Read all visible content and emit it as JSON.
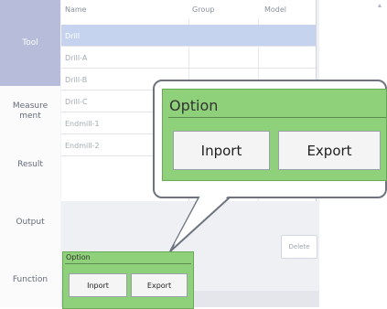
{
  "sidebar": {
    "items": [
      {
        "label": "Tool",
        "active": true
      },
      {
        "label": "Measure\nment",
        "active": false
      },
      {
        "label": "Result",
        "active": false
      },
      {
        "label": "Output",
        "active": false
      },
      {
        "label": "Function",
        "active": false
      }
    ]
  },
  "table": {
    "columns": [
      "Name",
      "Group",
      "Model"
    ],
    "rows": [
      {
        "name": "Drill",
        "selected": true
      },
      {
        "name": "Drill-A",
        "selected": false
      },
      {
        "name": "Drill-B",
        "selected": false
      },
      {
        "name": "Drill-C",
        "selected": false
      },
      {
        "name": "Endmill-1",
        "selected": false
      },
      {
        "name": "Endmill-2",
        "selected": false
      }
    ]
  },
  "delete_label": "Delete",
  "option_panel": {
    "title": "Option",
    "import_label": "Inport",
    "export_label": "Export"
  },
  "callout": {
    "title": "Option",
    "import_label": "Inport",
    "export_label": "Export"
  },
  "colors": {
    "active_sidebar": "#b6bcd9",
    "selected_row": "#c5d3ef",
    "option_green": "#8fd07a"
  }
}
